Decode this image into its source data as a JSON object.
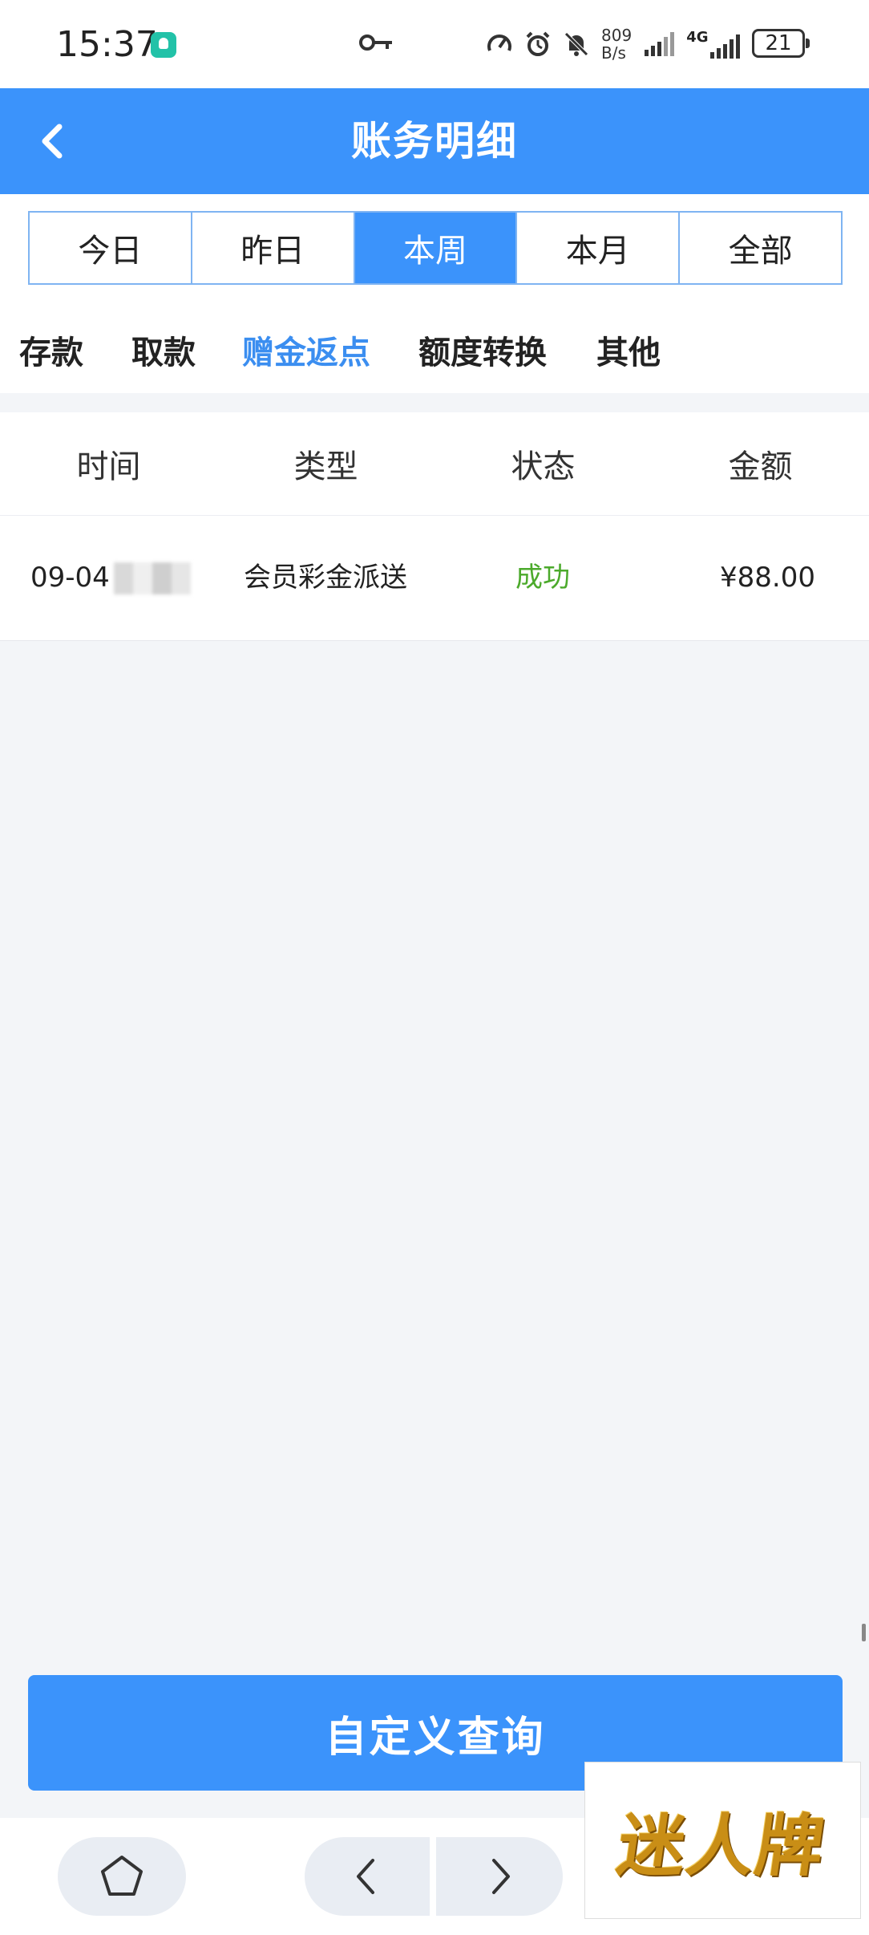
{
  "status_bar": {
    "time": "15:37",
    "net_speed_value": "809",
    "net_speed_unit": "B/s",
    "network": "4G",
    "battery": "21"
  },
  "header": {
    "title": "账务明细"
  },
  "period_tabs": [
    {
      "label": "今日"
    },
    {
      "label": "昨日"
    },
    {
      "label": "本周",
      "active": true
    },
    {
      "label": "本月"
    },
    {
      "label": "全部"
    }
  ],
  "type_tabs": [
    {
      "label": "存款"
    },
    {
      "label": "取款"
    },
    {
      "label": "赠金返点",
      "active": true
    },
    {
      "label": "额度转换"
    },
    {
      "label": "其他"
    }
  ],
  "table": {
    "headers": [
      "时间",
      "类型",
      "状态",
      "金额"
    ],
    "rows": [
      {
        "time": "09-04",
        "type": "会员彩金派送",
        "status": "成功",
        "amount": "¥88.00"
      }
    ]
  },
  "query_button": "自定义查询",
  "watermark": "迷人牌",
  "colors": {
    "primary": "#3b93fb",
    "tab_border": "#7fb4f2",
    "active_type_tab": "#3b8ef0",
    "success": "#4caa2c",
    "background": "#f3f5f8"
  }
}
